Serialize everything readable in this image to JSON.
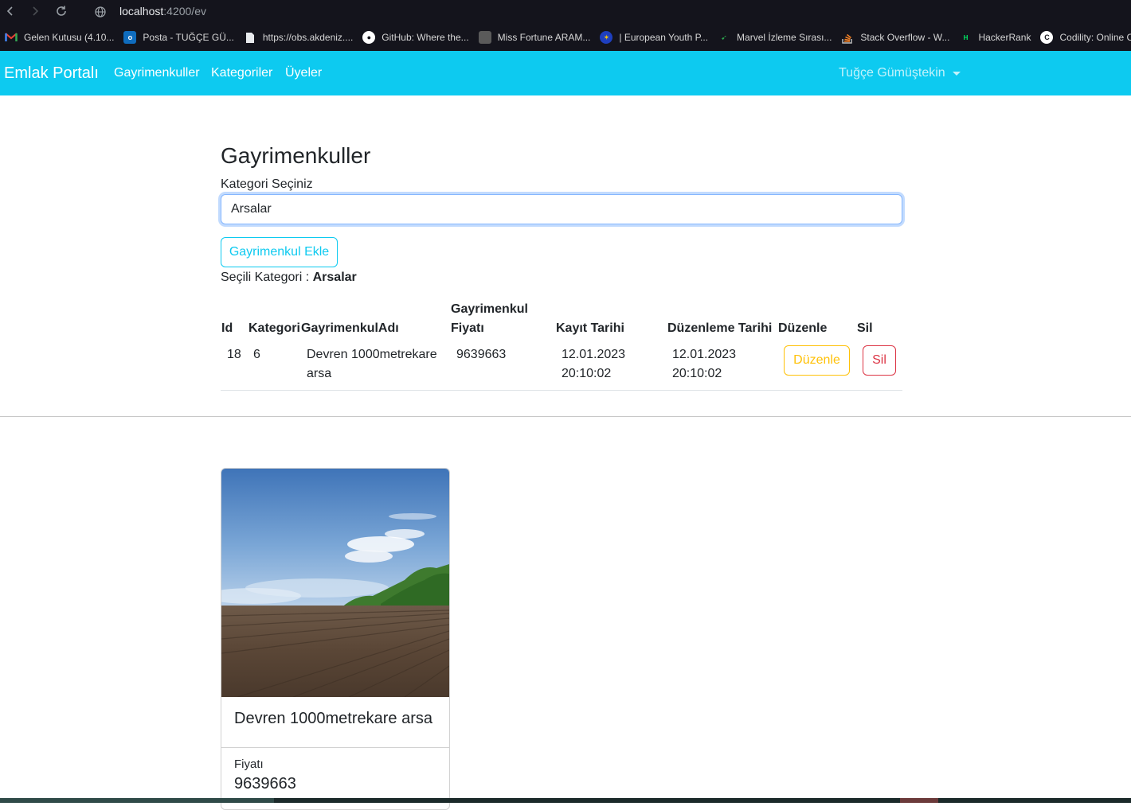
{
  "browser": {
    "url_host": "localhost",
    "url_path": ":4200/ev",
    "bookmarks": [
      {
        "label": "Gelen Kutusu (4.10...",
        "icon": "gmail-icon",
        "color": "#ea4335"
      },
      {
        "label": "Posta - TUĞÇE GÜ...",
        "icon": "outlook-icon",
        "color": "#0f6cbd"
      },
      {
        "label": "https://obs.akdeniz....",
        "icon": "document-icon",
        "color": "#e8eaed"
      },
      {
        "label": "GitHub: Where the...",
        "icon": "github-icon",
        "color": "#ffffff"
      },
      {
        "label": "Miss Fortune ARAM...",
        "icon": "game-icon",
        "color": "#8a8a8a"
      },
      {
        "label": "| European Youth P...",
        "icon": "eu-flag-icon",
        "color": "#1e3fbf"
      },
      {
        "label": "Marvel İzleme Sırası...",
        "icon": "bookmark-site-icon",
        "color": "#2da44e"
      },
      {
        "label": "Stack Overflow - W...",
        "icon": "stackoverflow-icon",
        "color": "#f48024"
      },
      {
        "label": "HackerRank",
        "icon": "hackerrank-icon",
        "color": "#00ea64"
      },
      {
        "label": "Codility: Online Co...",
        "icon": "codility-icon",
        "color": "#ffffff"
      }
    ]
  },
  "navbar": {
    "brand": "Emlak Portalı",
    "links": [
      "Gayrimenkuller",
      "Kategoriler",
      "Üyeler"
    ],
    "user": "Tuğçe Gümüştekin",
    "bg_color": "#0dcaf0"
  },
  "page": {
    "title": "Gayrimenkuller",
    "select_label": "Kategori Seçiniz",
    "select_value": "Arsalar",
    "add_button": "Gayrimenkul Ekle",
    "selected_prefix": "Seçili Kategori : ",
    "selected_value": "Arsalar"
  },
  "table": {
    "headers": {
      "id": "Id",
      "category": "Kategori",
      "name": "GayrimenkulAdı",
      "price_line1": "Gayrimenkul",
      "price_line2": "Fiyatı",
      "created": "Kayıt Tarihi",
      "updated": "Düzenleme Tarihi",
      "edit": "Düzenle",
      "delete": "Sil"
    },
    "row": {
      "id": "18",
      "category": "6",
      "name_line1": "Devren 1000metrekare",
      "name_line2": "arsa",
      "price": "9639663",
      "created_date": "12.01.2023",
      "created_time": "20:10:02",
      "updated_date": "12.01.2023",
      "updated_time": "20:10:02",
      "edit_button": "Düzenle",
      "delete_button": "Sil"
    }
  },
  "card": {
    "title": "Devren 1000metrekare arsa",
    "price_label": "Fiyatı",
    "price_value": "9639663",
    "image_description": "plowed-field-photo"
  }
}
